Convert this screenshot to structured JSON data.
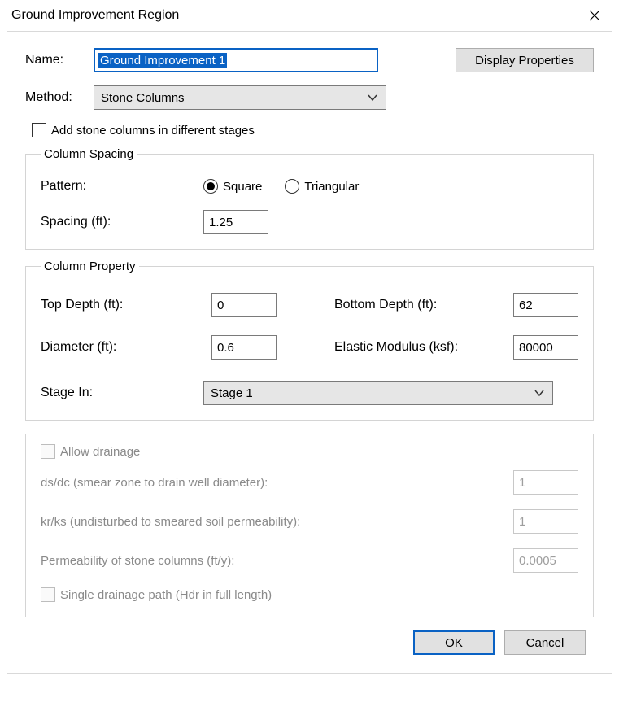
{
  "window": {
    "title": "Ground Improvement Region"
  },
  "name": {
    "label": "Name:",
    "value": "Ground Improvement 1"
  },
  "display_btn": "Display Properties",
  "method": {
    "label": "Method:",
    "value": "Stone Columns"
  },
  "add_stages_chk": "Add stone columns in different stages",
  "column_spacing": {
    "legend": "Column Spacing",
    "pattern_label": "Pattern:",
    "pattern_options": {
      "square": "Square",
      "triangular": "Triangular"
    },
    "pattern_value": "square",
    "spacing_label": "Spacing (ft):",
    "spacing_value": "1.25"
  },
  "column_property": {
    "legend": "Column Property",
    "top_depth_label": "Top Depth (ft):",
    "top_depth_value": "0",
    "bottom_depth_label": "Bottom Depth (ft):",
    "bottom_depth_value": "62",
    "diameter_label": "Diameter (ft):",
    "diameter_value": "0.6",
    "modulus_label": "Elastic Modulus (ksf):",
    "modulus_value": "80000",
    "stage_label": "Stage In:",
    "stage_value": "Stage 1"
  },
  "drainage": {
    "allow_label": "Allow drainage",
    "dsdc_label": "ds/dc (smear zone to drain well diameter):",
    "dsdc_value": "1",
    "krks_label": "kr/ks (undisturbed to smeared soil permeability):",
    "krks_value": "1",
    "perm_label": "Permeability of stone columns (ft/y):",
    "perm_value": "0.0005",
    "single_label": "Single drainage path (Hdr in full length)"
  },
  "footer": {
    "ok": "OK",
    "cancel": "Cancel"
  }
}
